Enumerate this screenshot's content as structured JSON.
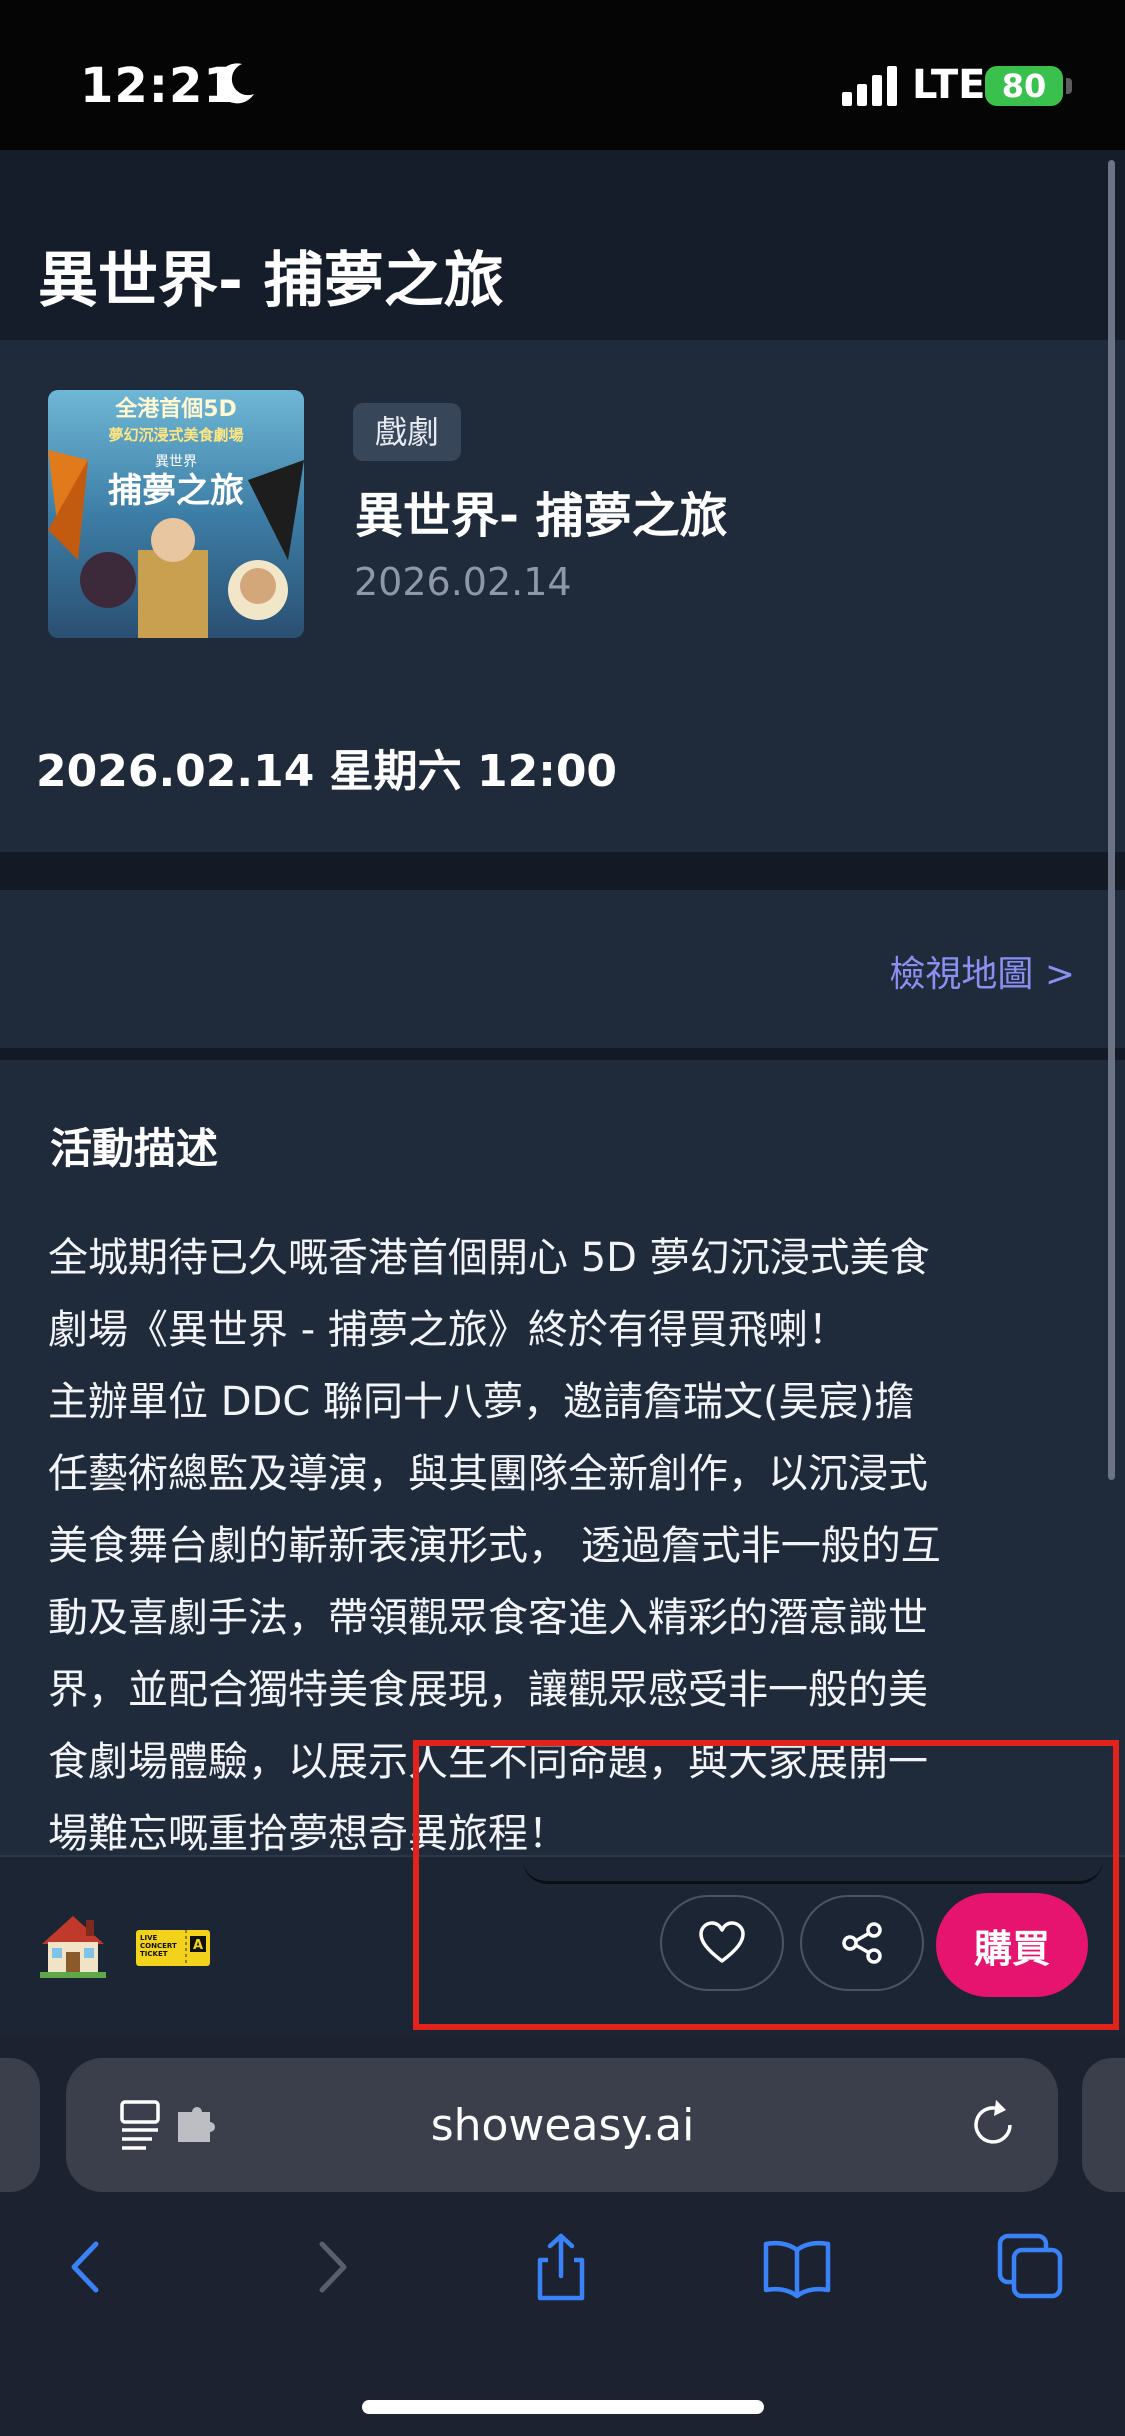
{
  "status_bar": {
    "time": "12:21",
    "network": "LTE",
    "battery": "80"
  },
  "header": {
    "title": "異世界- 捕夢之旅"
  },
  "event": {
    "category": "戲劇",
    "name": "異世界- 捕夢之旅",
    "date": "2026.02.14",
    "datetime": "2026.02.14 星期六 12:00",
    "poster_text": [
      "全港首個5D",
      "夢幻沉浸式美食劇場",
      "異世界",
      "捕夢之旅"
    ]
  },
  "location": {
    "map_link": "檢視地圖 >"
  },
  "description": {
    "title": "活動描述",
    "body": "全城期待已久嘅香港首個開心 5D 夢幻沉浸式美食\n劇場《異世界 - 捕夢之旅》終於有得買飛喇！\n主辦單位 DDC 聯同十八夢，邀請詹瑞文(昊宸)擔\n任藝術總監及導演，與其團隊全新創作，以沉浸式\n美食舞台劇的嶄新表演形式， 透過詹式非一般的互\n動及喜劇手法，帶領觀眾食客進入精彩的潛意識世\n界，並配合獨特美食展現，讓觀眾感受非一般的美\n食劇場體驗，以展示人生不同命題，與大家展開一\n場難忘嘅重拾夢想奇異旅程！"
  },
  "actions": {
    "favorite_icon": "heart-icon",
    "share_icon": "share-icon",
    "buy_label": "購買",
    "ticket_emoji_text": [
      "LIVE",
      "CONCERT",
      "TICKET",
      "A"
    ]
  },
  "browser": {
    "url": "showeasy.ai"
  },
  "colors": {
    "accent": "#e6136f",
    "link": "#8a8ff0",
    "highlight": "#e1231b",
    "battery": "#3ac04c",
    "ios_blue": "#3a82f7"
  }
}
